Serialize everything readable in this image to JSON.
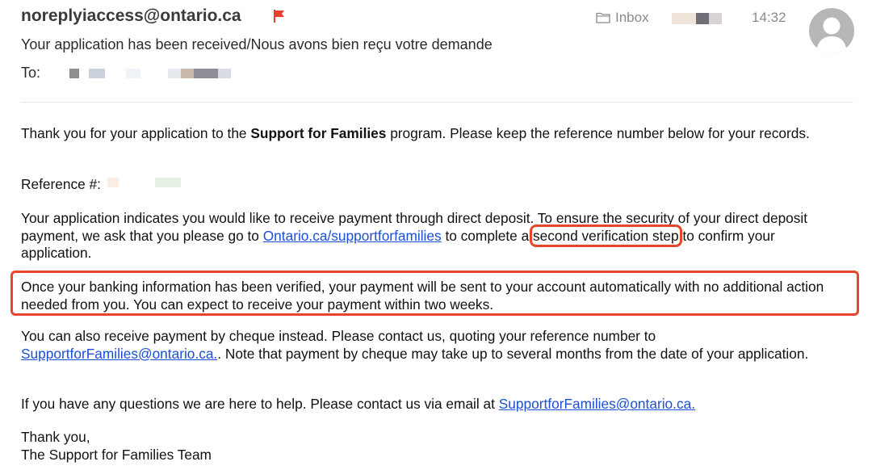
{
  "header": {
    "sender": "noreplyiaccess@ontario.ca",
    "subject": "Your application has been received/Nous avons bien reçu votre demande",
    "to_label": "To:",
    "mailbox": "Inbox",
    "time": "14:32",
    "flag_color": "#e8412f"
  },
  "body": {
    "p1_before": "Thank you for your application to the ",
    "p1_bold": "Support for Families",
    "p1_after": " program. Please keep the reference number below for your records.",
    "ref_label": "Reference #:",
    "p3_before": "Your application indicates you would like to receive payment through direct deposit. To ensure the security of your direct deposit payment, we ask that you please go to ",
    "p3_link": "Ontario.ca/supportforfamilies",
    "p3_mid": " to complete a ",
    "p3_highlight": "second verification step",
    "p3_after": " to confirm your application.",
    "p4": "Once your banking information has been verified, your payment will be sent to your account automatically with no additional action needed from you. You can expect to receive your payment within two weeks.",
    "p5_before": "You can also receive payment by cheque instead. Please contact us, quoting your reference number to ",
    "p5_link": "SupportforFamilies@ontario.ca.",
    "p5_after": ". Note that payment by cheque may take up to several months from the date of your application.",
    "p6_before": "If you have any questions we are here to help. Please contact us via email at ",
    "p6_link": "SupportforFamilies@ontario.ca.",
    "signoff": "Thank you,",
    "signature": "The Support for Families Team"
  },
  "colors": {
    "highlight": "#e8452c",
    "link": "#1a4fd6"
  }
}
